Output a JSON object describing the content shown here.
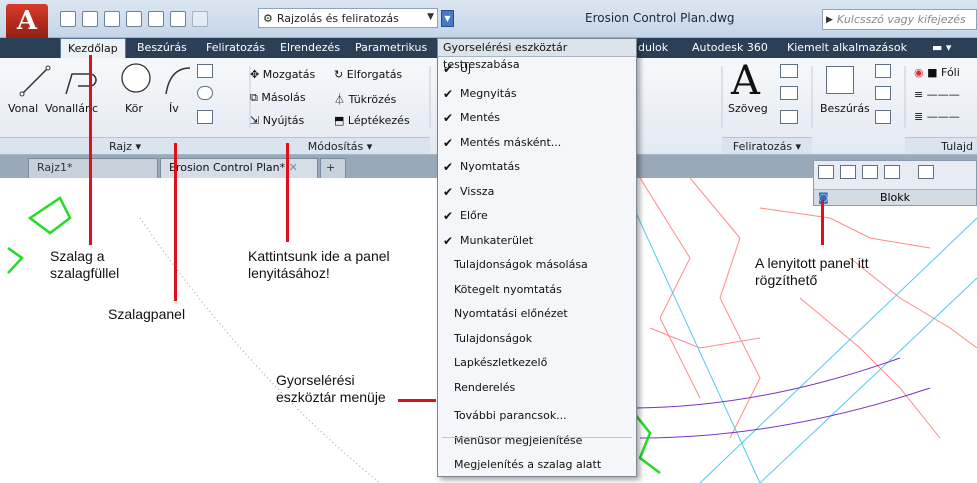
{
  "app": {
    "logo_letter": "A",
    "doc_title": "Erosion Control Plan.dwg",
    "workspace": "Rajzolás és feliratozás",
    "search_placeholder": "Kulcsszó vagy kifejezés"
  },
  "tabs": [
    {
      "label": "Kezdőlap",
      "active": true
    },
    {
      "label": "Beszúrás"
    },
    {
      "label": "Feliratozás"
    },
    {
      "label": "Elrendezés"
    },
    {
      "label": "Parametrikus"
    },
    {
      "label": "dulok"
    },
    {
      "label": "Autodesk 360"
    },
    {
      "label": "Kiemelt alkalmazások"
    }
  ],
  "ribbon": {
    "rajz": {
      "title": "Rajz",
      "vonal": "Vonal",
      "vonallanc": "Vonallánc",
      "kor": "Kör",
      "iv": "Ív"
    },
    "modositas": {
      "title": "Módosítás",
      "mozgatas": "Mozgatás",
      "elforgatas": "Elforgatás",
      "masolas": "Másolás",
      "tukrozes": "Tükrözés",
      "nyujtas": "Nyújtás",
      "leptekezes": "Léptékezés"
    },
    "feliratozas": {
      "title": "Feliratozás",
      "szoveg": "Szöveg",
      "big_letter": "A"
    },
    "blokk": {
      "beszuras": "Beszúrás"
    },
    "tulajdonsagok": {
      "folia": "Fóli",
      "title": "Tulajd"
    }
  },
  "doc_tabs": [
    "Rajz1*",
    "Erosion Control Plan*"
  ],
  "float_panel": {
    "title": "Blokk"
  },
  "qat_menu": {
    "title": "Gyorselérési eszköztár testreszabása",
    "items": [
      {
        "label": "Új",
        "checked": true
      },
      {
        "label": "Megnyitás",
        "checked": true
      },
      {
        "label": "Mentés",
        "checked": true
      },
      {
        "label": "Mentés másként...",
        "checked": true
      },
      {
        "label": "Nyomtatás",
        "checked": true
      },
      {
        "label": "Vissza",
        "checked": true
      },
      {
        "label": "Előre",
        "checked": true
      },
      {
        "label": "Munkaterület",
        "checked": true
      },
      {
        "label": "Tulajdonságok másolása",
        "checked": false
      },
      {
        "label": "Kötegelt nyomtatás",
        "checked": false
      },
      {
        "label": "Nyomtatási előnézet",
        "checked": false
      },
      {
        "label": "Tulajdonságok",
        "checked": false
      },
      {
        "label": "Lapkészletkezelő",
        "checked": false
      },
      {
        "label": "Renderelés",
        "checked": false
      },
      {
        "label": "További parancsok...",
        "checked": false
      },
      {
        "label": "Menüsor megjelenítése",
        "checked": false
      },
      {
        "label": "Megjelenítés a szalag alatt",
        "checked": false
      }
    ]
  },
  "annotations": {
    "szalag_fulle_1": "Szalag a",
    "szalag_fulle_2": "szalagfüllel",
    "szalagpanel": "Szalagpanel",
    "kattintsunk_1": "Kattintsunk ide a panel",
    "kattintsunk_2": "lenyitásához!",
    "gyors_1": "Gyorselérési",
    "gyors_2": "eszköztár menüje",
    "lenyitott_1": "A lenyitott panel itt",
    "lenyitott_2": "rögzíthető"
  },
  "colors": {
    "accent_red": "#e0101a",
    "menu_bg": "#f4f6f9",
    "titlebar": "#c5d5e8",
    "menubar": "#2b3f57"
  }
}
